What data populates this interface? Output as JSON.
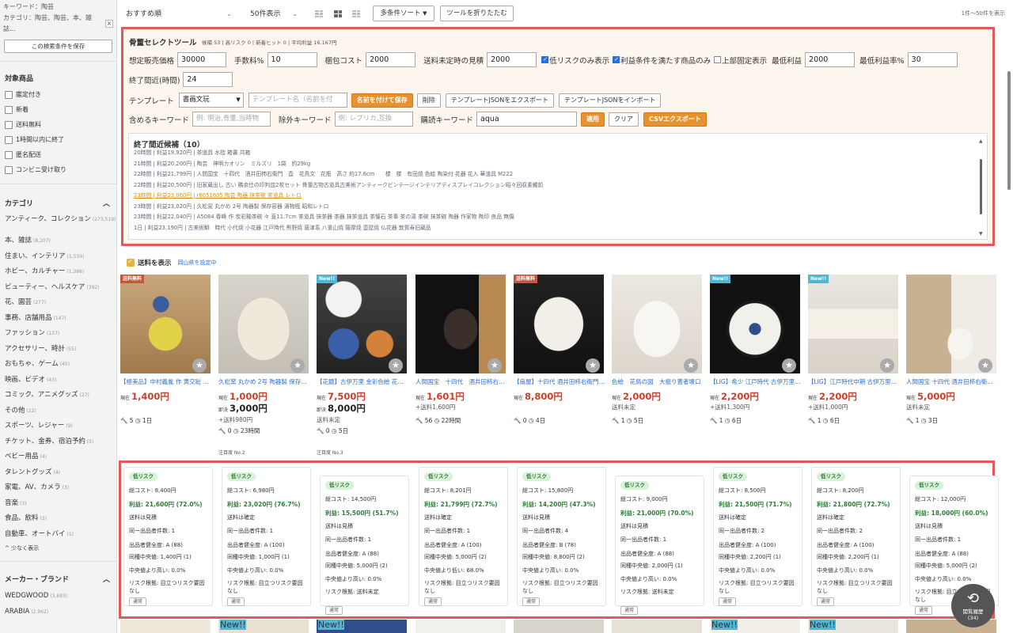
{
  "sidebar": {
    "keyword_line": "キーワード：陶芸",
    "category_line": "カテゴリ：陶芸、陶芸、本、雑誌…",
    "clear_x": "×",
    "save_button": "この検索条件を保存",
    "target_title": "対象商品",
    "checks": [
      "鑑定付き",
      "新着",
      "送料無料",
      "1時間以内に終了",
      "匿名配送",
      "コンビニ受け取り"
    ],
    "category_title": "カテゴリ",
    "categories": [
      {
        "name": "アンティーク、コレクション",
        "count": "(273,519)"
      },
      {
        "name": "本、雑誌",
        "count": "(8,207)"
      },
      {
        "name": "住まい、インテリア",
        "count": "(1,539)"
      },
      {
        "name": "ホビー、カルチャー",
        "count": "(1,386)"
      },
      {
        "name": "ビューティー、ヘルスケア",
        "count": "(392)"
      },
      {
        "name": "花、園芸",
        "count": "(277)"
      },
      {
        "name": "事務、店舗用品",
        "count": "(147)"
      },
      {
        "name": "ファッション",
        "count": "(137)"
      },
      {
        "name": "アクセサリー、時計",
        "count": "(55)"
      },
      {
        "name": "おもちゃ、ゲーム",
        "count": "(45)"
      },
      {
        "name": "映画、ビデオ",
        "count": "(43)"
      },
      {
        "name": "コミック、アニメグッズ",
        "count": "(27)"
      },
      {
        "name": "その他",
        "count": "(22)"
      },
      {
        "name": "スポーツ、レジャー",
        "count": "(9)"
      },
      {
        "name": "チケット、金券、宿泊予約",
        "count": "(5)"
      },
      {
        "name": "ベビー用品",
        "count": "(4)"
      },
      {
        "name": "タレントグッズ",
        "count": "(4)"
      },
      {
        "name": "家電、AV、カメラ",
        "count": "(3)"
      },
      {
        "name": "音楽",
        "count": "(3)"
      },
      {
        "name": "食品、飲料",
        "count": "(2)"
      },
      {
        "name": "自動車、オートバイ",
        "count": "(1)"
      }
    ],
    "show_less": "^ 少なく表示",
    "maker_title": "メーカー・ブランド",
    "makers": [
      {
        "name": "WEDGWOOD",
        "count": "(3,693)"
      },
      {
        "name": "ARABIA",
        "count": "(2,962)"
      }
    ]
  },
  "toolbar": {
    "sort": "おすすめ順",
    "per_page": "50件表示",
    "multi_sort": "多条件ソート",
    "fold_tools": "ツールを折りたたむ",
    "count": "1件～50件を表示"
  },
  "tools": {
    "title": "骨董セレクトツール",
    "stats": "候補 53 | 高リスク 0 | 新着ヒット 0 | 平均利益 16,167円",
    "price_label": "想定販売価格",
    "price_value": "30000",
    "fee_label": "手数料%",
    "fee_value": "10",
    "pack_label": "梱包コスト",
    "pack_value": "2000",
    "ship_est_label": "送料未定時の見積",
    "ship_est_value": "2000",
    "low_risk_only": "低リスクのみ表示",
    "profit_ok_only": "利益条件を満たす商品のみ",
    "pin_top": "上部固定表示",
    "min_profit_label": "最低利益",
    "min_profit_value": "2000",
    "min_margin_label": "最低利益率%",
    "min_margin_value": "30",
    "near_end_label": "終了間近(時間)",
    "near_end_value": "24",
    "template_label": "テンプレート",
    "template_value": "書画文玩",
    "template_name_ph": "テンプレート名（名前を付",
    "save_named": "名前を付けて保存",
    "delete": "削除",
    "export_json": "テンプレートJSONをエクスポート",
    "import_json": "テンプレートJSONをインポート",
    "include_label": "含めるキーワード",
    "include_ph": "例: 明治,骨董,当時物",
    "exclude_label": "除外キーワード",
    "exclude_ph": "例: レプリカ,互換",
    "buy_label": "購読キーワード",
    "buy_value": "aqua",
    "apply": "適用",
    "clear": "クリア",
    "csv": "CSVエクスポート",
    "end_title": "終了間近候補（10）",
    "end_lines": [
      "20時間 | 利益19,920円 | 茶道具 水指 箱書 共箱",
      "21時間 | 利益20,200円 | 陶芸　神明カオリン　ミルズリ　1袋　約29kg",
      "22時間 | 利益21,799円 | 人間国宝　十四代　酒井田柿右衛門　壺　花鳥文　花瓶　高さ 約17.6cm　　楼　楼　有田焼 色絵 陶染付 花器 花入 華道具 M222",
      "22時間 | 利益20,500円 | 旧家蔵出し 古い 隣余仕の印判皿2枚セット 骨董古物古道具古美術アンティークビンテージインテリアディスプレイコレクション昭々回収素觸前",
      "23時間 | 利益23,060円 | r8051605 陶芸 陶器 抹茶碗 茶道具 レトロ",
      "23時間 | 利益23,020円 | 久松窯 丸かめ 2号 陶器製 保存容器 漬物瓶 昭和レトロ",
      "23時間 | 利益22,040円 | A5084 春峰 作 炭彩釉茶碗 々 直11.7cm 茶道具 抹茶器 茶器 抹茶道具 茶懐石 茶事 茶の湯 茶碗 抹茶碗 陶器 作家物 陶印 良品 無傷",
      "1日 | 利益23,190円 | 古美術鰤　時代 小代焼 小花器 江戸時代 熊野焼 唐津系 八重山焼 薩摩焼 壺屋焼 仏花器 敦賀寿旧蔵品"
    ],
    "end_scroll_up": "▲",
    "end_scroll_down": "▼"
  },
  "ship_filter": {
    "label": "送料を表示",
    "note": "岡山県を設定中"
  },
  "products": [
    {
      "badge": "送料無料",
      "title": "【極美品】中村義胤 作 黄交趾 …",
      "price": "1,400円",
      "price_lbl": "現在",
      "bin": "",
      "bin_lbl": "",
      "ship": "",
      "bids": "5",
      "time": "1日",
      "note": ""
    },
    {
      "badge": "",
      "title": "久松窯 丸かめ 2号 陶器製 保存…",
      "price": "1,000円",
      "price_lbl": "現在",
      "bin": "3,000円",
      "bin_lbl": "即決",
      "ship": "+送料980円",
      "bids": "0",
      "time": "23時間",
      "note": "注目度 No.2"
    },
    {
      "badge": "New!!",
      "title": "【花鏡】古伊万里 金彩色絵 花…",
      "price": "7,500円",
      "price_lbl": "現在",
      "bin": "8,000円",
      "bin_lbl": "即決",
      "ship": "送料未定",
      "bids": "0",
      "time": "5日",
      "note": "注目度 No.3"
    },
    {
      "badge": "",
      "title": "人間国宝　十四代　酒井田柿右…",
      "price": "1,601円",
      "price_lbl": "現在",
      "bin": "",
      "bin_lbl": "",
      "ship": "+送料1,600円",
      "bids": "56",
      "time": "22時間",
      "note": ""
    },
    {
      "badge": "送料無料",
      "title": "【扇屋】十四代 酒井田柿右衛門…",
      "price": "8,800円",
      "price_lbl": "現在",
      "bin": "",
      "bin_lbl": "",
      "ship": "",
      "bids": "0",
      "time": "4日",
      "note": ""
    },
    {
      "badge": "",
      "title": "色絵　花鳥の図　大振り蓋者壊口",
      "price": "2,000円",
      "price_lbl": "現在",
      "bin": "",
      "bin_lbl": "",
      "ship": "送料未定",
      "bids": "1",
      "time": "5日",
      "note": ""
    },
    {
      "badge": "New!!",
      "title": "【LIG】希少 江戸時代 古伊万里…",
      "price": "2,200円",
      "price_lbl": "現在",
      "bin": "",
      "bin_lbl": "",
      "ship": "+送料1,300円",
      "bids": "1",
      "time": "6日",
      "note": ""
    },
    {
      "badge": "New!!",
      "title": "【LIG】江戸時代中期 古伊万里…",
      "price": "2,200円",
      "price_lbl": "現在",
      "bin": "",
      "bin_lbl": "",
      "ship": "+送料1,000円",
      "bids": "1",
      "time": "6日",
      "note": ""
    },
    {
      "badge": "",
      "title": "人間国宝 十四代 酒井田柿右衛…",
      "price": "5,000円",
      "price_lbl": "現在",
      "bin": "",
      "bin_lbl": "",
      "ship": "送料未定",
      "bids": "1",
      "time": "3日",
      "note": ""
    }
  ],
  "risk_cards": [
    {
      "risk": "低リスク",
      "cost": "総コスト: 8,400円",
      "profit": "利益: 21,600円 (72.0%)",
      "ship": "送料は見積",
      "same": "同一出品者件数: 1",
      "score": "出品者健全度: A (88)",
      "median": "同種中央値: 1,400円 (1)",
      "above": "中央値より高い: 0.0%",
      "basis": "リスク根拠: 目立つリスク要因なし",
      "tag": "通常"
    },
    {
      "risk": "低リスク",
      "cost": "総コスト: 6,980円",
      "profit": "利益: 23,020円 (76.7%)",
      "ship": "送料は確定",
      "same": "同一出品者件数: 1",
      "score": "出品者健全度: A (100)",
      "median": "同種中央値: 1,000円 (1)",
      "above": "中央値より高い: 0.0%",
      "basis": "リスク根拠: 目立つリスク要因なし",
      "tag": "通常"
    },
    {
      "risk": "低リスク",
      "cost": "総コスト: 14,500円",
      "profit": "利益: 15,500円 (51.7%)",
      "ship": "送料は見積",
      "same": "同一出品者件数: 1",
      "score": "出品者健全度: A (88)",
      "median": "同種中央値: 5,000円 (2)",
      "above": "中央値より高い: 0.0%",
      "basis": "リスク根拠: 送料未定",
      "tag": "通常"
    },
    {
      "risk": "低リスク",
      "cost": "総コスト: 8,201円",
      "profit": "利益: 21,799円 (72.7%)",
      "ship": "送料は確定",
      "same": "同一出品者件数: 1",
      "score": "出品者健全度: A (100)",
      "median": "同種中央値: 5,000円 (2)",
      "above": "中央値より低い: 68.0%",
      "basis": "リスク根拠: 目立つリスク要因なし",
      "tag": "通常"
    },
    {
      "risk": "低リスク",
      "cost": "総コスト: 15,800円",
      "profit": "利益: 14,200円 (47.3%)",
      "ship": "送料は見積",
      "same": "同一出品者件数: 4",
      "score": "出品者健全度: B (78)",
      "median": "同種中央値: 8,800円 (2)",
      "above": "中央値より高い: 0.0%",
      "basis": "リスク根拠: 目立つリスク要因なし",
      "tag": "通常"
    },
    {
      "risk": "低リスク",
      "cost": "総コスト: 9,000円",
      "profit": "利益: 21,000円 (70.0%)",
      "ship": "送料は見積",
      "same": "同一出品者件数: 1",
      "score": "出品者健全度: A (88)",
      "median": "同種中央値: 2,000円 (1)",
      "above": "中央値より高い: 0.0%",
      "basis": "リスク根拠: 送料未定",
      "tag": "通常"
    },
    {
      "risk": "低リスク",
      "cost": "総コスト: 8,500円",
      "profit": "利益: 21,500円 (71.7%)",
      "ship": "送料は確定",
      "same": "同一出品者件数: 2",
      "score": "出品者健全度: A (100)",
      "median": "同種中央値: 2,200円 (1)",
      "above": "中央値より高い: 0.0%",
      "basis": "リスク根拠: 目立つリスク要因なし",
      "tag": "通常"
    },
    {
      "risk": "低リスク",
      "cost": "総コスト: 8,200円",
      "profit": "利益: 21,800円 (72.7%)",
      "ship": "送料は確定",
      "same": "同一出品者件数: 2",
      "score": "出品者健全度: A (100)",
      "median": "同種中央値: 2,200円 (1)",
      "above": "中央値より高い: 0.0%",
      "basis": "リスク根拠: 目立つリスク要因なし",
      "tag": "通常"
    },
    {
      "risk": "低リスク",
      "cost": "総コスト: 12,000円",
      "profit": "利益: 18,000円 (60.0%)",
      "ship": "送料は見積",
      "same": "同一出品者件数: 1",
      "score": "出品者健全度: A (88)",
      "median": "同種中央値: 5,000円 (2)",
      "above": "中央値より高い: 0.0%",
      "basis": "リスク根拠: 目立つリスク要因なし",
      "tag": "通常"
    }
  ],
  "history": {
    "label": "閲覧履歴",
    "count": "(34)"
  }
}
